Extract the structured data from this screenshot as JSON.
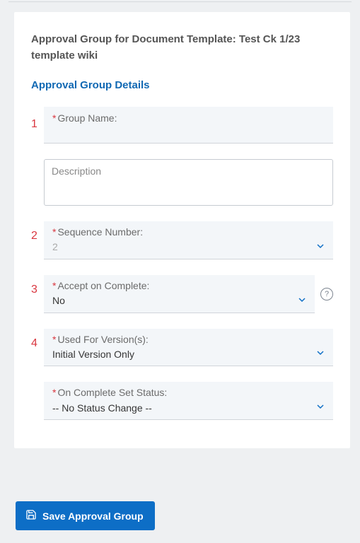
{
  "page": {
    "title": "Approval Group for Document Template: Test Ck 1/23 template wiki",
    "section_title": "Approval Group Details"
  },
  "steps": {
    "one": "1",
    "two": "2",
    "three": "3",
    "four": "4"
  },
  "fields": {
    "group_name": {
      "label": "Group Name:",
      "value": ""
    },
    "description": {
      "placeholder": "Description"
    },
    "sequence": {
      "label": "Sequence Number:",
      "value": "2"
    },
    "accept": {
      "label": "Accept on Complete:",
      "value": "No"
    },
    "used_for": {
      "label": "Used For Version(s):",
      "value": "Initial Version Only"
    },
    "on_complete": {
      "label": "On Complete Set Status:",
      "value": "-- No Status Change --"
    }
  },
  "buttons": {
    "save": "Save Approval Group"
  },
  "required_marker": "*"
}
